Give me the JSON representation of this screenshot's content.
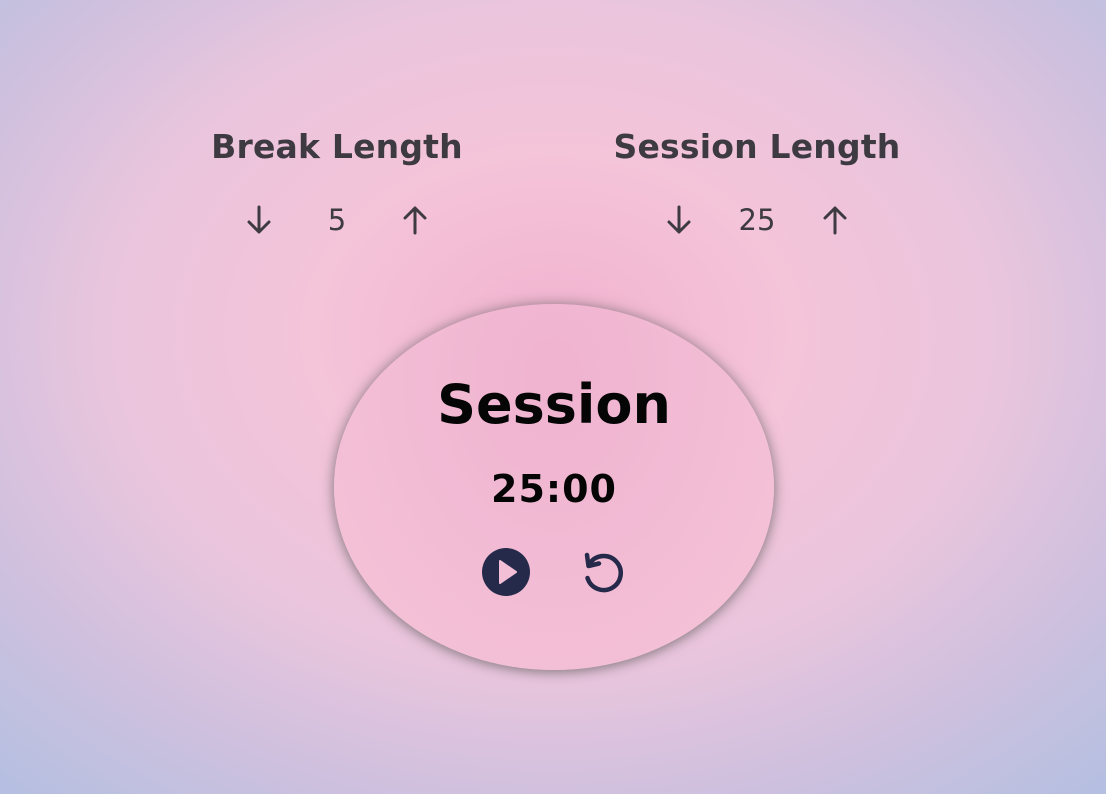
{
  "break": {
    "title": "Break Length",
    "value": "5",
    "decrement_icon": "arrow-down-icon",
    "increment_icon": "arrow-up-icon"
  },
  "session": {
    "title": "Session Length",
    "value": "25",
    "decrement_icon": "arrow-down-icon",
    "increment_icon": "arrow-up-icon"
  },
  "timer": {
    "label": "Session",
    "time": "25:00",
    "play_icon": "play-circle-icon",
    "reset_icon": "reset-icon"
  },
  "colors": {
    "text_dark": "#3d3a42",
    "icon_navy": "#25294a",
    "timer_bg": "#f3bfd6",
    "bg_center": "#f2b3d0",
    "bg_edge": "#afbfe2"
  }
}
